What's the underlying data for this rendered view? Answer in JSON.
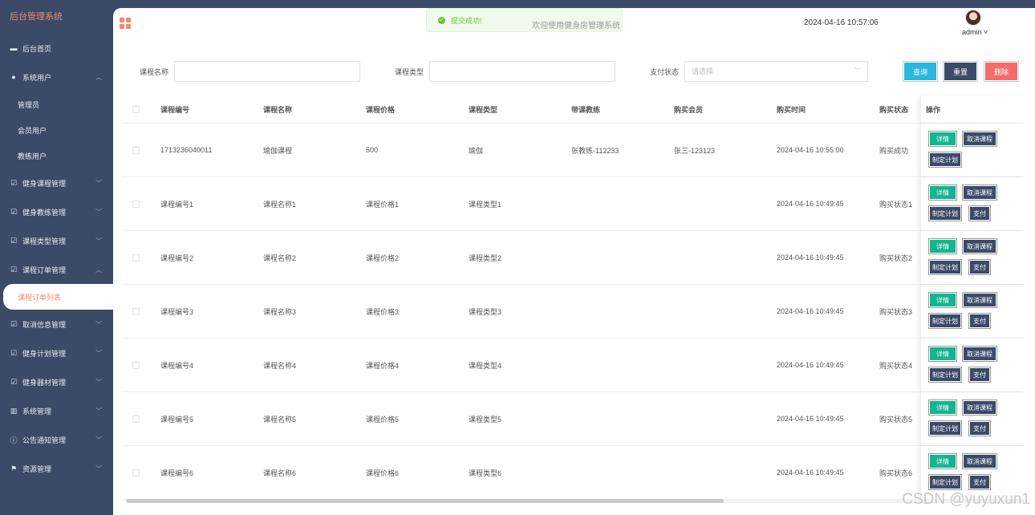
{
  "sidebar": {
    "brand": "后台管理系统",
    "items": [
      {
        "label": "后台首页",
        "icon": "monitor-icon"
      },
      {
        "label": "系统用户",
        "icon": "user-icon",
        "expanded": true
      },
      {
        "label": "健身课程管理",
        "icon": "checkbox-icon"
      },
      {
        "label": "健身教练管理",
        "icon": "checkbox-icon"
      },
      {
        "label": "课程类型管理",
        "icon": "checkbox-icon"
      },
      {
        "label": "课程订单管理",
        "icon": "checkbox-icon",
        "expanded": true
      },
      {
        "label": "取消信息管理",
        "icon": "checkbox-icon"
      },
      {
        "label": "健身计划管理",
        "icon": "checkbox-icon"
      },
      {
        "label": "健身器材管理",
        "icon": "checkbox-icon"
      },
      {
        "label": "系统管理",
        "icon": "bar-chart-icon"
      },
      {
        "label": "公告通知管理",
        "icon": "info-icon"
      },
      {
        "label": "资源管理",
        "icon": "flag-icon"
      }
    ],
    "sub_system_user": [
      "管理员",
      "会员用户",
      "教练用户"
    ],
    "sub_order": [
      "课程订单列表"
    ]
  },
  "header": {
    "toast": "提交成功!",
    "welcome": "欢迎使用健身房管理系统",
    "datetime": "2024-04-16 10:57:06",
    "username": "admin"
  },
  "search": {
    "course_name_label": "课程名称",
    "course_type_label": "课程类型",
    "pay_status_label": "支付状态",
    "pay_status_placeholder": "请选择",
    "query_btn": "查询",
    "reset_btn": "重置",
    "delete_btn": "删除"
  },
  "table": {
    "columns": [
      "课程编号",
      "课程名称",
      "课程价格",
      "课程类型",
      "带课教练",
      "购买会员",
      "购买时间",
      "购买状态",
      "操作"
    ],
    "rows": [
      {
        "code": "1713236040011",
        "name": "瑜伽课程",
        "price": "500",
        "type": "瑜伽",
        "coach": "张教练-112233",
        "member": "张三-123123",
        "time": "2024-04-16 10:55:00",
        "status": "购买成功",
        "has_pay": false
      },
      {
        "code": "课程编号1",
        "name": "课程名称1",
        "price": "课程价格1",
        "type": "课程类型1",
        "coach": "",
        "member": "",
        "time": "2024-04-16 10:49:45",
        "status": "购买状态1",
        "has_pay": true
      },
      {
        "code": "课程编号2",
        "name": "课程名称2",
        "price": "课程价格2",
        "type": "课程类型2",
        "coach": "",
        "member": "",
        "time": "2024-04-16 10:49:45",
        "status": "购买状态2",
        "has_pay": true
      },
      {
        "code": "课程编号3",
        "name": "课程名称3",
        "price": "课程价格3",
        "type": "课程类型3",
        "coach": "",
        "member": "",
        "time": "2024-04-16 10:49:45",
        "status": "购买状态3",
        "has_pay": true
      },
      {
        "code": "课程编号4",
        "name": "课程名称4",
        "price": "课程价格4",
        "type": "课程类型4",
        "coach": "",
        "member": "",
        "time": "2024-04-16 10:49:45",
        "status": "购买状态4",
        "has_pay": true
      },
      {
        "code": "课程编号5",
        "name": "课程名称5",
        "price": "课程价格5",
        "type": "课程类型5",
        "coach": "",
        "member": "",
        "time": "2024-04-16 10:49:45",
        "status": "购买状态5",
        "has_pay": true
      },
      {
        "code": "课程编号6",
        "name": "课程名称6",
        "price": "课程价格6",
        "type": "课程类型6",
        "coach": "",
        "member": "",
        "time": "2024-04-16 10:49:45",
        "status": "购买状态6",
        "has_pay": true
      }
    ],
    "actions": {
      "detail": "详情",
      "cancel": "取消课程",
      "plan": "制定计划",
      "pay": "支付"
    }
  },
  "watermark": "CSDN @yuyuxun1",
  "colors": {
    "sidebar_bg": "#3b4a66",
    "accent": "#f08a70",
    "detail_btn": "#13b58f",
    "query_btn": "#28b8e0",
    "delete_btn": "#f56c6c"
  }
}
